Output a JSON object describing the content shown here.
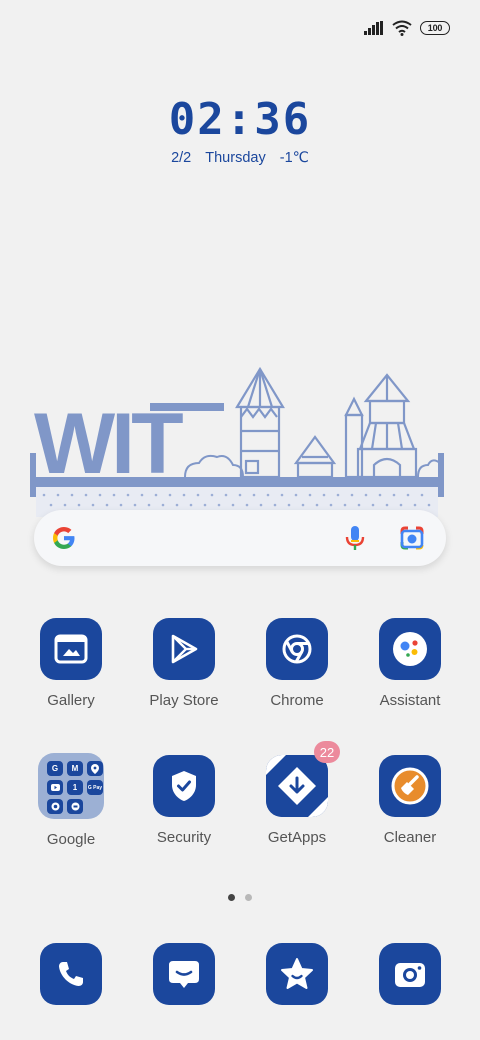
{
  "status_bar": {
    "battery": "100",
    "icons": [
      "signal-icon",
      "wifi-icon",
      "battery-icon"
    ]
  },
  "clock": {
    "time": "02:36",
    "date": "2/2",
    "weekday": "Thursday",
    "temperature": "-1℃"
  },
  "widget": {
    "text": "WIT"
  },
  "search": {
    "icons": [
      "google-logo-icon",
      "microphone-icon",
      "google-lens-icon"
    ]
  },
  "apps": [
    {
      "label": "Gallery",
      "icon": "gallery-icon"
    },
    {
      "label": "Play Store",
      "icon": "play-store-icon"
    },
    {
      "label": "Chrome",
      "icon": "chrome-icon"
    },
    {
      "label": "Assistant",
      "icon": "assistant-icon"
    },
    {
      "label": "Google",
      "icon": "folder-icon"
    },
    {
      "label": "Security",
      "icon": "security-shield-icon"
    },
    {
      "label": "GetApps",
      "icon": "getapps-icon",
      "badge": "22"
    },
    {
      "label": "Cleaner",
      "icon": "cleaner-brush-icon"
    }
  ],
  "folder_apps": [
    "G",
    "M",
    "",
    "",
    "1",
    "G Pay",
    "",
    ""
  ],
  "dock": [
    {
      "icon": "phone-icon"
    },
    {
      "icon": "messages-icon"
    },
    {
      "icon": "themes-star-icon"
    },
    {
      "icon": "camera-icon"
    }
  ],
  "colors": {
    "accent": "#1b479d",
    "background": "#f1f1f1",
    "widget_blue": "#8097c8",
    "badge": "#ec8a9c"
  },
  "pages": {
    "count": 2,
    "current": 1
  }
}
